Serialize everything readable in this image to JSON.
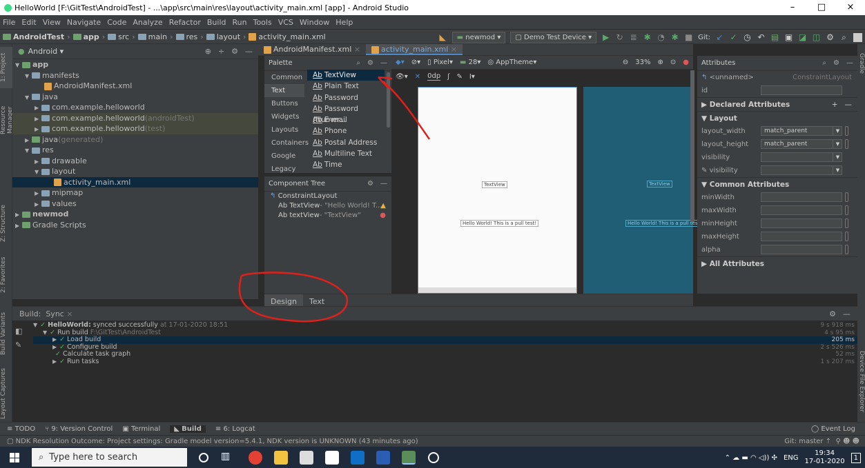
{
  "title_bar": {
    "title": "HelloWorld [F:\\GitTest\\AndroidTest] - ...\\app\\src\\main\\res\\layout\\activity_main.xml [app] - Android Studio",
    "minimize": "–",
    "maximize": "□",
    "close": "×"
  },
  "menu": [
    "File",
    "Edit",
    "View",
    "Navigate",
    "Code",
    "Analyze",
    "Refactor",
    "Build",
    "Run",
    "Tools",
    "VCS",
    "Window",
    "Help"
  ],
  "breadcrumbs": [
    "AndroidTest",
    "app",
    "src",
    "main",
    "res",
    "layout",
    "activity_main.xml"
  ],
  "toolbar": {
    "config": "newmod",
    "device": "Demo Test Device",
    "git_label": "Git:"
  },
  "side_tabs": {
    "project": "1: Project",
    "resource": "Resource Manager",
    "structure": "Z: Structure",
    "favorites": "2: Favorites",
    "variants": "Build Variants",
    "captures": "Layout Captures",
    "gradle": "Gradle",
    "device_explorer": "Device File Explorer"
  },
  "project": {
    "view": "Android",
    "items": [
      {
        "label": "app",
        "indent": 0,
        "bold": true,
        "open": true
      },
      {
        "label": "manifests",
        "indent": 1,
        "open": true
      },
      {
        "label": "AndroidManifest.xml",
        "indent": 3,
        "file": true
      },
      {
        "label": "java",
        "indent": 1,
        "open": true
      },
      {
        "label": "com.example.helloworld",
        "indent": 2
      },
      {
        "label": "com.example.helloworld",
        "suffix": "(androidTest)",
        "indent": 2,
        "hl": true
      },
      {
        "label": "com.example.helloworld",
        "suffix": "(test)",
        "indent": 2,
        "hl": true
      },
      {
        "label": "java",
        "suffix": "(generated)",
        "indent": 1
      },
      {
        "label": "res",
        "indent": 1,
        "open": true
      },
      {
        "label": "drawable",
        "indent": 2
      },
      {
        "label": "layout",
        "indent": 2,
        "open": true
      },
      {
        "label": "activity_main.xml",
        "indent": 4,
        "file": true,
        "sel": true
      },
      {
        "label": "mipmap",
        "indent": 2
      },
      {
        "label": "values",
        "indent": 2
      },
      {
        "label": "newmod",
        "indent": 0,
        "bold": true
      },
      {
        "label": "Gradle Scripts",
        "indent": 0
      }
    ]
  },
  "editor_tabs": [
    {
      "label": "AndroidManifest.xml",
      "active": false
    },
    {
      "label": "activity_main.xml",
      "active": true
    }
  ],
  "palette": {
    "title": "Palette",
    "categories": [
      "Common",
      "Text",
      "Buttons",
      "Widgets",
      "Layouts",
      "Containers",
      "Google",
      "Legacy"
    ],
    "active_category": "Text",
    "items": [
      {
        "ab": "Ab",
        "label": "TextView"
      },
      {
        "ab": "Ab",
        "label": "Plain Text"
      },
      {
        "ab": "Ab",
        "label": "Password"
      },
      {
        "ab": "Ab",
        "label": "Password (Numer..."
      },
      {
        "ab": "Ab",
        "label": "E-mail"
      },
      {
        "ab": "Ab",
        "label": "Phone"
      },
      {
        "ab": "Ab",
        "label": "Postal Address"
      },
      {
        "ab": "Ab",
        "label": "Multiline Text"
      },
      {
        "ab": "Ab",
        "label": "Time"
      }
    ]
  },
  "component_tree": {
    "title": "Component Tree",
    "root": "ConstraintLayout",
    "children": [
      {
        "label": "Ab TextView",
        "detail": "- \"Hello World! T...",
        "status": "warning"
      },
      {
        "label": "Ab textView",
        "detail": "- \"TextView\"",
        "status": "error"
      }
    ]
  },
  "design_toolbar": {
    "margin": "0dp",
    "device": "Pixel",
    "api": "28",
    "theme": "AppTheme",
    "zoom": "33%"
  },
  "canvas": {
    "textview_label": "TextView",
    "hello_label": "Hello World! This is a pull test!",
    "hello_label_blue": "Hello World! This is a pull test!"
  },
  "bottom_tabs": [
    "Design",
    "Text"
  ],
  "active_bottom_tab": "Design",
  "attributes": {
    "title": "Attributes",
    "component": "<unnamed>",
    "class": "ConstraintLayout",
    "id_label": "id",
    "declared": "Declared Attributes",
    "layout": "Layout",
    "layout_rows": [
      {
        "label": "layout_width",
        "value": "match_parent"
      },
      {
        "label": "layout_height",
        "value": "match_parent"
      },
      {
        "label": "visibility",
        "value": ""
      },
      {
        "label": "visibility",
        "value": "",
        "tool": true
      }
    ],
    "common": "Common Attributes",
    "common_rows": [
      "minWidth",
      "maxWidth",
      "minHeight",
      "maxHeight",
      "alpha"
    ],
    "all": "All Attributes"
  },
  "build": {
    "label": "Build:",
    "tab": "Sync",
    "rows": [
      {
        "text": "HelloWorld:",
        "rest": " synced successfully",
        "suffix": " at 17-01-2020 18:51",
        "time": "9 s 918 ms",
        "level": 0
      },
      {
        "text": "Run build",
        "suffix": " F:\\GitTest\\AndroidTest",
        "time": "4 s 95 ms",
        "level": 1
      },
      {
        "text": "Load build",
        "time": "205 ms",
        "level": 2,
        "sel": true
      },
      {
        "text": "Configure build",
        "time": "2 s 526 ms",
        "level": 2
      },
      {
        "text": "Calculate task graph",
        "time": "52 ms",
        "level": 2
      },
      {
        "text": "Run tasks",
        "time": "1 s 207 ms",
        "level": 2
      }
    ]
  },
  "bottom_tools": [
    "TODO",
    "9: Version Control",
    "Terminal",
    "Build",
    "6: Logcat"
  ],
  "event_log": "Event Log",
  "status": {
    "message": "NDK Resolution Outcome: Project settings: Gradle model version=5.4.1, NDK version is UNKNOWN (43 minutes ago)",
    "git": "Git: master ⇡"
  },
  "taskbar": {
    "search_placeholder": "Type here to search",
    "lang": "ENG",
    "time": "19:34",
    "date": "17-01-2020",
    "notif": "1"
  },
  "colors": {
    "annotation": "#e0211b",
    "accent": "#4a88c7"
  }
}
